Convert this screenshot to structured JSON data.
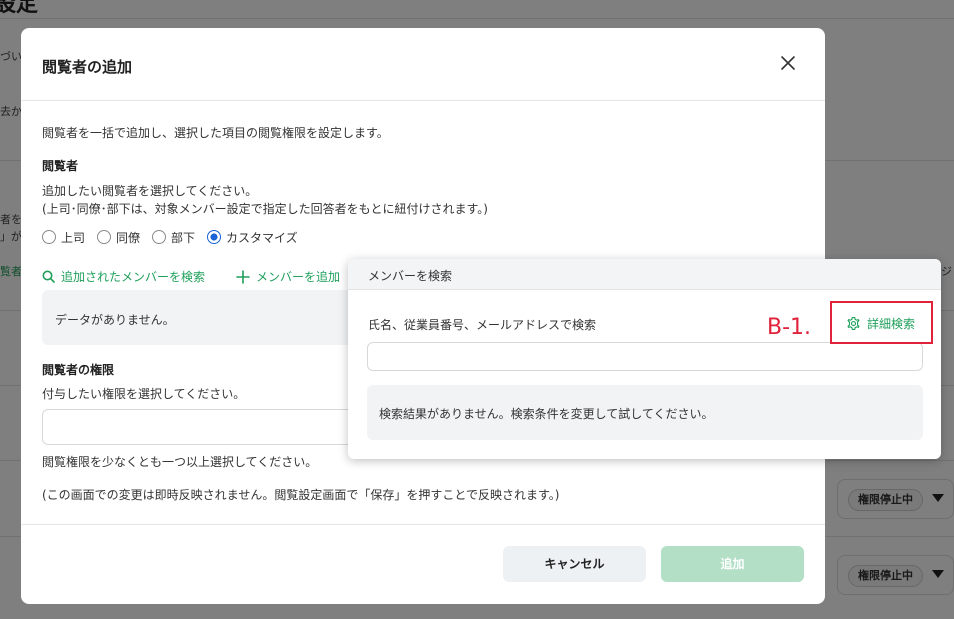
{
  "background": {
    "title": "設定",
    "fragments": [
      "づい",
      "去か",
      "者を",
      "」が",
      "覧者",
      "ジ"
    ],
    "badges": [
      "権限停止中",
      "権限停止中"
    ]
  },
  "modal": {
    "title": "閲覧者の追加",
    "description": "閲覧者を一括で追加し、選択した項目の閲覧権限を設定します。",
    "viewers": {
      "heading": "閲覧者",
      "instruction": "追加したい閲覧者を選択してください。",
      "note": "(上司･同僚･部下は、対象メンバー設定で指定した回答者をもとに紐付けされます。)",
      "options": [
        {
          "label": "上司",
          "selected": false
        },
        {
          "label": "同僚",
          "selected": false
        },
        {
          "label": "部下",
          "selected": false
        },
        {
          "label": "カスタマイズ",
          "selected": true
        }
      ],
      "search_link": "追加されたメンバーを検索",
      "add_link": "メンバーを追加",
      "empty_text": "データがありません。"
    },
    "permission": {
      "heading": "閲覧者の権限",
      "instruction": "付与したい権限を選択してください。",
      "hint": "閲覧権限を少なくとも一つ以上選択してください。"
    },
    "notice": "(この画面での変更は即時反映されません。閲覧設定画面で「保存」を押すことで反映されます。)",
    "cancel_label": "キャンセル",
    "add_label": "追加"
  },
  "search_popover": {
    "title": "メンバーを検索",
    "field_label": "氏名、従業員番号、メールアドレスで検索",
    "advanced_label": "詳細検索",
    "search_value": "",
    "no_result": "検索結果がありません。検索条件を変更して試してください。"
  },
  "annotation": {
    "label": "B-1.",
    "color": "#e0223a"
  },
  "colors": {
    "accent_green": "#1f9f5b",
    "radio_selected": "#1a62d6",
    "add_button": "#b3dfc6"
  }
}
